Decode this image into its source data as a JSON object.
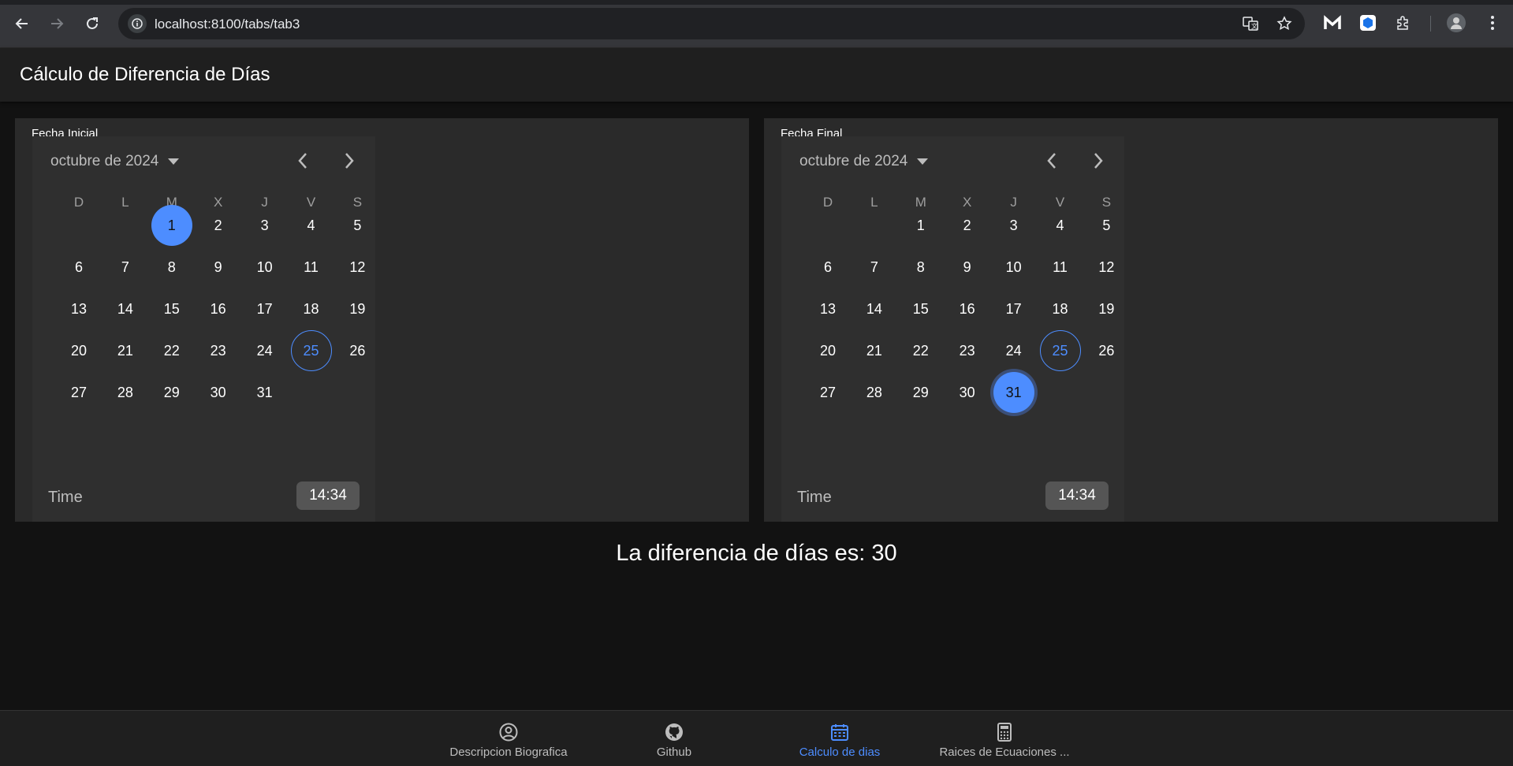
{
  "browser": {
    "url": "localhost:8100/tabs/tab3"
  },
  "app": {
    "title": "Cálculo de Diferencia de Días"
  },
  "calendars": [
    {
      "label": "Fecha Inicial",
      "month_label": "octubre de 2024",
      "weekdays": [
        "D",
        "L",
        "M",
        "X",
        "J",
        "V",
        "S"
      ],
      "days": [
        "1",
        "2",
        "3",
        "4",
        "5",
        "6",
        "7",
        "8",
        "9",
        "10",
        "11",
        "12",
        "13",
        "14",
        "15",
        "16",
        "17",
        "18",
        "19",
        "20",
        "21",
        "22",
        "23",
        "24",
        "25",
        "26",
        "27",
        "28",
        "29",
        "30",
        "31"
      ],
      "first_weekday_index": 2,
      "selected_day": "1",
      "today_day": "25",
      "time_label": "Time",
      "time_value": "14:34"
    },
    {
      "label": "Fecha Final",
      "month_label": "octubre de 2024",
      "weekdays": [
        "D",
        "L",
        "M",
        "X",
        "J",
        "V",
        "S"
      ],
      "days": [
        "1",
        "2",
        "3",
        "4",
        "5",
        "6",
        "7",
        "8",
        "9",
        "10",
        "11",
        "12",
        "13",
        "14",
        "15",
        "16",
        "17",
        "18",
        "19",
        "20",
        "21",
        "22",
        "23",
        "24",
        "25",
        "26",
        "27",
        "28",
        "29",
        "30",
        "31"
      ],
      "first_weekday_index": 2,
      "selected_day": "31",
      "today_day": "25",
      "time_label": "Time",
      "time_value": "14:34"
    }
  ],
  "result_text": "La diferencia de días es: 30",
  "tabs": [
    {
      "label": "Descripcion Biografica",
      "icon": "person-circle-icon"
    },
    {
      "label": "Github",
      "icon": "github-icon"
    },
    {
      "label": "Calculo de dias",
      "icon": "calendar-icon",
      "active": true
    },
    {
      "label": "Raices de Ecuaciones ...",
      "icon": "calculator-icon"
    }
  ],
  "colors": {
    "accent": "#4d8dff",
    "background": "#121212",
    "card": "#2a2a2a"
  }
}
